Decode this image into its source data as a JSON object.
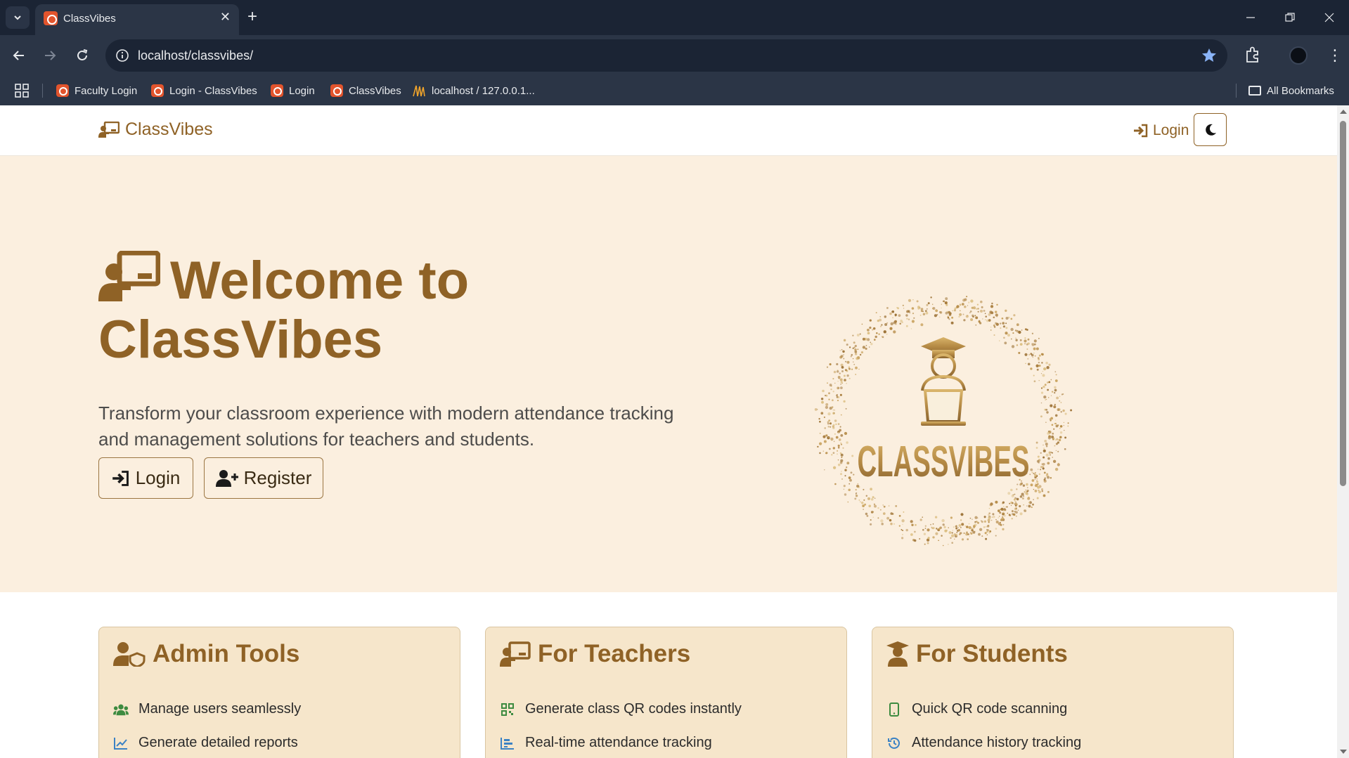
{
  "browser": {
    "tab_title": "ClassVibes",
    "url": "localhost/classvibes/",
    "bookmarks": [
      {
        "label": "Faculty Login",
        "icon": "xampp-icon"
      },
      {
        "label": "Login - ClassVibes",
        "icon": "xampp-icon"
      },
      {
        "label": "Login",
        "icon": "xampp-icon"
      },
      {
        "label": "ClassVibes",
        "icon": "xampp-icon"
      },
      {
        "label": "localhost / 127.0.0.1...",
        "icon": "phpmyadmin-icon"
      }
    ],
    "all_bookmarks_label": "All Bookmarks"
  },
  "nav": {
    "brand": "ClassVibes",
    "login_label": "Login",
    "theme_toggle_icon": "moon-icon"
  },
  "hero": {
    "title_line1": "Welcome to",
    "title_line2": "ClassVibes",
    "subtitle": "Transform your classroom experience with modern attendance tracking and management solutions for teachers and students.",
    "login_button": "Login",
    "register_button": "Register",
    "logo_text": "CLASSVIBES"
  },
  "features": [
    {
      "title": "Admin Tools",
      "icon": "user-shield-icon",
      "items": [
        {
          "label": "Manage users seamlessly",
          "icon": "users-icon"
        },
        {
          "label": "Generate detailed reports",
          "icon": "chart-line-icon"
        }
      ]
    },
    {
      "title": "For Teachers",
      "icon": "chalkboard-teacher-icon",
      "items": [
        {
          "label": "Generate class QR codes instantly",
          "icon": "qrcode-icon"
        },
        {
          "label": "Real-time attendance tracking",
          "icon": "chart-bar-icon"
        }
      ]
    },
    {
      "title": "For Students",
      "icon": "user-graduate-icon",
      "items": [
        {
          "label": "Quick QR code scanning",
          "icon": "mobile-icon"
        },
        {
          "label": "Attendance history tracking",
          "icon": "history-icon"
        }
      ]
    }
  ],
  "colors": {
    "brand": "#8f6226",
    "hero_bg": "#fbefdf",
    "card_bg": "#f6e6cb",
    "chrome_dark": "#1b2434",
    "chrome": "#2b3546",
    "item_icon_green": "#3d8b40",
    "item_icon_blue": "#3b82c4"
  }
}
